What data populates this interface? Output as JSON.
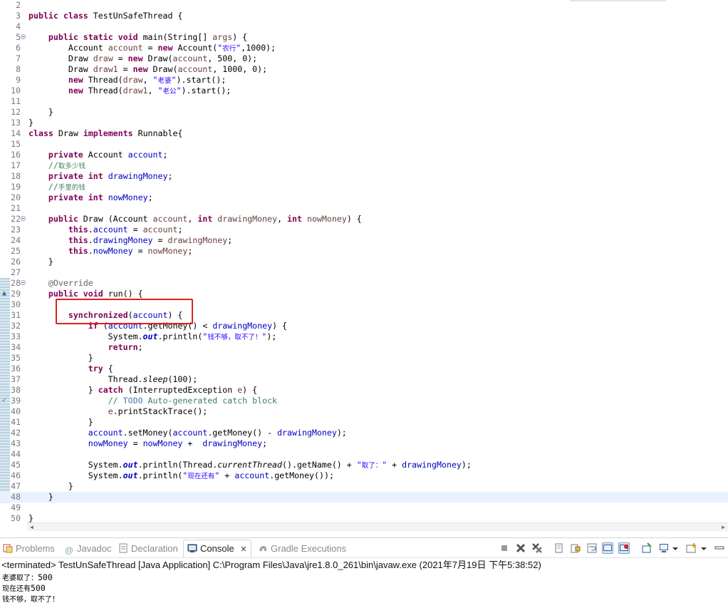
{
  "editor": {
    "file_class": "TestUnSafeThread",
    "lines": [
      {
        "n": "2",
        "t": ""
      },
      {
        "n": "3",
        "t": "public class TestUnSafeThread {"
      },
      {
        "n": "4",
        "t": ""
      },
      {
        "n": "5",
        "t": "    public static void main(String[] args) {"
      },
      {
        "n": "6",
        "t": "        Account account = new Account(\"农行\",1000);"
      },
      {
        "n": "7",
        "t": "        Draw draw = new Draw(account, 500, 0);"
      },
      {
        "n": "8",
        "t": "        Draw draw1 = new Draw(account, 1000, 0);"
      },
      {
        "n": "9",
        "t": "        new Thread(draw, \"老婆\").start();"
      },
      {
        "n": "10",
        "t": "        new Thread(draw1, \"老公\").start();"
      },
      {
        "n": "11",
        "t": ""
      },
      {
        "n": "12",
        "t": "    }"
      },
      {
        "n": "13",
        "t": "}"
      },
      {
        "n": "14",
        "t": "class Draw implements Runnable{"
      },
      {
        "n": "15",
        "t": ""
      },
      {
        "n": "16",
        "t": "    private Account account;"
      },
      {
        "n": "17",
        "t": "    //取多少钱"
      },
      {
        "n": "18",
        "t": "    private int drawingMoney;"
      },
      {
        "n": "19",
        "t": "    //手里的钱"
      },
      {
        "n": "20",
        "t": "    private int nowMoney;"
      },
      {
        "n": "21",
        "t": ""
      },
      {
        "n": "22",
        "t": "    public Draw (Account account, int drawingMoney, int nowMoney) {"
      },
      {
        "n": "23",
        "t": "        this.account = account;"
      },
      {
        "n": "24",
        "t": "        this.drawingMoney = drawingMoney;"
      },
      {
        "n": "25",
        "t": "        this.nowMoney = nowMoney;"
      },
      {
        "n": "26",
        "t": "    }"
      },
      {
        "n": "27",
        "t": ""
      },
      {
        "n": "28",
        "t": "    @Override"
      },
      {
        "n": "29",
        "t": "    public void run() {"
      },
      {
        "n": "30",
        "t": ""
      },
      {
        "n": "31",
        "t": "        synchronized(account) {"
      },
      {
        "n": "32",
        "t": "            if (account.getMoney() < drawingMoney) {"
      },
      {
        "n": "33",
        "t": "                System.out.println(\"钱不够，取不了！\");"
      },
      {
        "n": "34",
        "t": "                return;"
      },
      {
        "n": "35",
        "t": "            }"
      },
      {
        "n": "36",
        "t": "            try {"
      },
      {
        "n": "37",
        "t": "                Thread.sleep(100);"
      },
      {
        "n": "38",
        "t": "            } catch (InterruptedException e) {"
      },
      {
        "n": "39",
        "t": "                // TODO Auto-generated catch block"
      },
      {
        "n": "40",
        "t": "                e.printStackTrace();"
      },
      {
        "n": "41",
        "t": "            }"
      },
      {
        "n": "42",
        "t": "            account.setMoney(account.getMoney() - drawingMoney);"
      },
      {
        "n": "43",
        "t": "            nowMoney = nowMoney +  drawingMoney;"
      },
      {
        "n": "44",
        "t": ""
      },
      {
        "n": "45",
        "t": "            System.out.println(Thread.currentThread().getName() + \"取了：\" + drawingMoney);"
      },
      {
        "n": "46",
        "t": "            System.out.println(\"现在还有\" + account.getMoney());"
      },
      {
        "n": "47",
        "t": "        }"
      },
      {
        "n": "48",
        "t": "    }"
      },
      {
        "n": "49",
        "t": ""
      },
      {
        "n": "50",
        "t": "}"
      }
    ],
    "fold_lines": [
      "5",
      "22",
      "28"
    ],
    "marker_lines": [
      "29",
      "39"
    ],
    "current_line": "48",
    "highlighted_line": "31"
  },
  "panel": {
    "tabs": [
      {
        "label": "Problems",
        "icon": "problems-icon"
      },
      {
        "label": "Javadoc",
        "icon": "javadoc-icon"
      },
      {
        "label": "Declaration",
        "icon": "declaration-icon"
      },
      {
        "label": "Console",
        "icon": "console-icon",
        "active": true,
        "close": "✕"
      },
      {
        "label": "Gradle Executions",
        "icon": "gradle-icon"
      }
    ],
    "toolbar": [
      "terminate-icon",
      "remove-launch-icon",
      "remove-all-terminated-icon",
      "clear-console-icon",
      "scroll-lock-icon",
      "word-wrap-icon",
      "show-console-on-output-icon",
      "show-console-on-error-icon",
      "pin-console-icon",
      "display-selected-console-icon",
      "open-console-icon"
    ]
  },
  "console": {
    "header": "<terminated> TestUnSafeThread [Java Application] C:\\Program Files\\Java\\jre1.8.0_261\\bin\\javaw.exe (2021年7月19日 下午5:38:52)",
    "output": [
      {
        "cn": "老婆取了：",
        "num": "500"
      },
      {
        "cn": "现在还有",
        "num": "500"
      },
      {
        "cn": "钱不够，取不了！",
        "num": ""
      }
    ]
  }
}
